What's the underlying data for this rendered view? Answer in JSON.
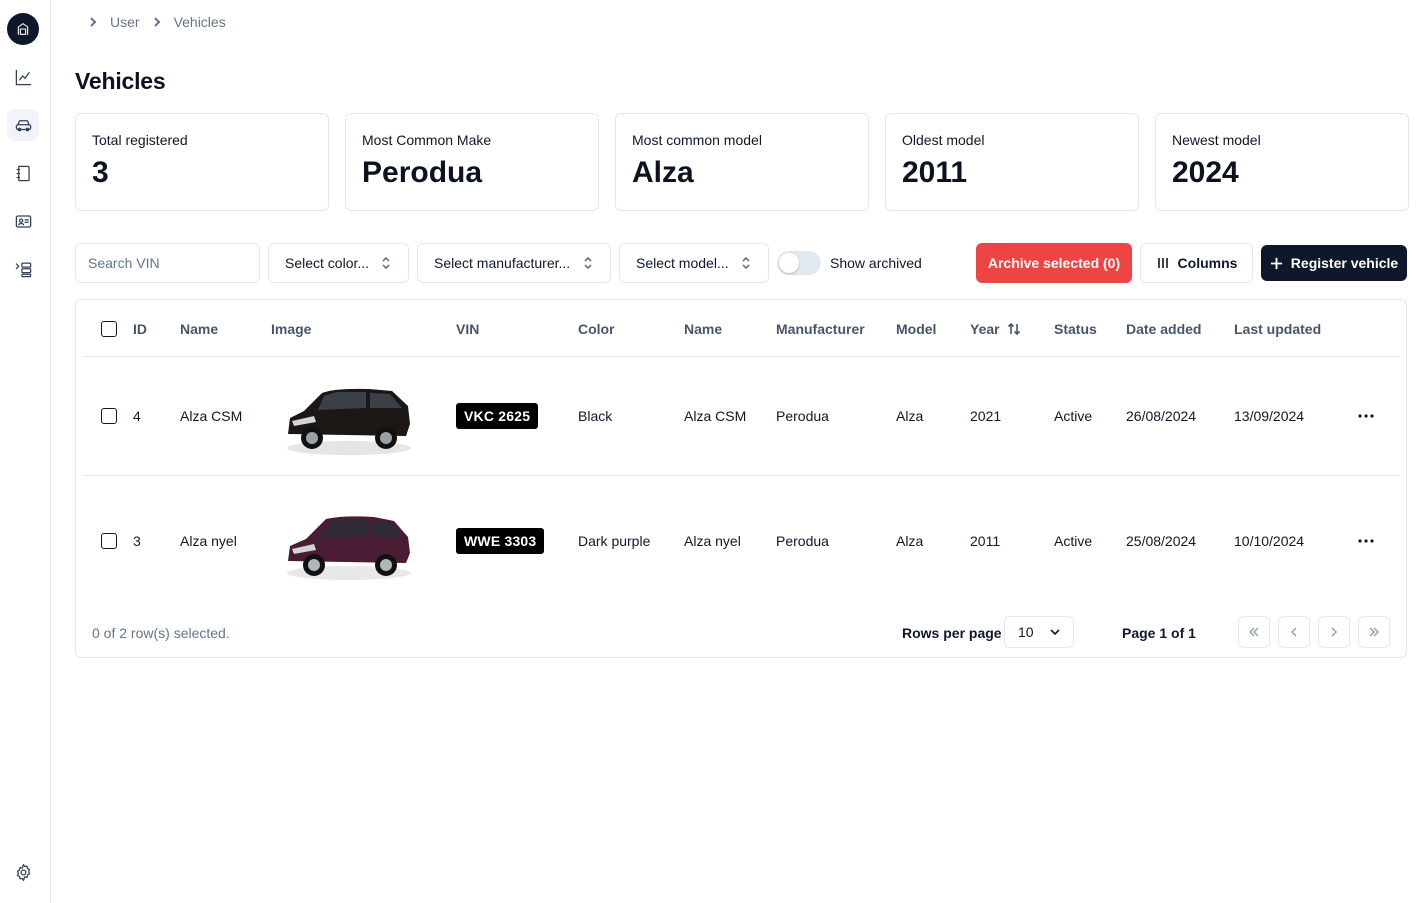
{
  "breadcrumb": [
    "User",
    "Vehicles"
  ],
  "page_title": "Vehicles",
  "sidebar": {
    "items": [
      {
        "icon": "garage-logo-icon"
      },
      {
        "icon": "chart-line-icon"
      },
      {
        "icon": "car-icon"
      },
      {
        "icon": "notebook-icon"
      },
      {
        "icon": "id-card-icon"
      },
      {
        "icon": "list-indent-icon"
      },
      {
        "icon": "settings-gear-icon"
      }
    ]
  },
  "stats": [
    {
      "label": "Total registered",
      "value": "3"
    },
    {
      "label": "Most Common Make",
      "value": "Perodua"
    },
    {
      "label": "Most common model",
      "value": "Alza"
    },
    {
      "label": "Oldest model",
      "value": "2011"
    },
    {
      "label": "Newest model",
      "value": "2024"
    }
  ],
  "toolbar": {
    "search_placeholder": "Search VIN",
    "color_select": "Select color...",
    "manufacturer_select": "Select manufacturer...",
    "model_select": "Select model...",
    "show_archived": "Show archived",
    "show_archived_on": false,
    "archive_button": "Archive selected (0)",
    "columns_button": "Columns",
    "register_button": "Register vehicle"
  },
  "table": {
    "headers": [
      "ID",
      "Name",
      "Image",
      "VIN",
      "Color",
      "Name",
      "Manufacturer",
      "Model",
      "Year",
      "Status",
      "Date added",
      "Last updated"
    ],
    "rows": [
      {
        "id": "4",
        "name": "Alza CSM",
        "vin": "VKC 2625",
        "color": "Black",
        "name2": "Alza CSM",
        "manufacturer": "Perodua",
        "model": "Alza",
        "year": "2021",
        "status": "Active",
        "date_added": "26/08/2024",
        "last_updated": "13/09/2024",
        "car_color": "#1c1614"
      },
      {
        "id": "3",
        "name": "Alza nyel",
        "vin": "WWE 3303",
        "color": "Dark purple",
        "name2": "Alza nyel",
        "manufacturer": "Perodua",
        "model": "Alza",
        "year": "2011",
        "status": "Active",
        "date_added": "25/08/2024",
        "last_updated": "10/10/2024",
        "car_color": "#4a1c33"
      }
    ]
  },
  "footer": {
    "selection": "0 of 2 row(s) selected.",
    "rows_per_page_label": "Rows per page",
    "rows_per_page": "10",
    "page_info": "Page 1 of 1"
  },
  "colors": {
    "danger": "#ef4444",
    "primary": "#0f172a",
    "border": "#e5e7eb"
  }
}
